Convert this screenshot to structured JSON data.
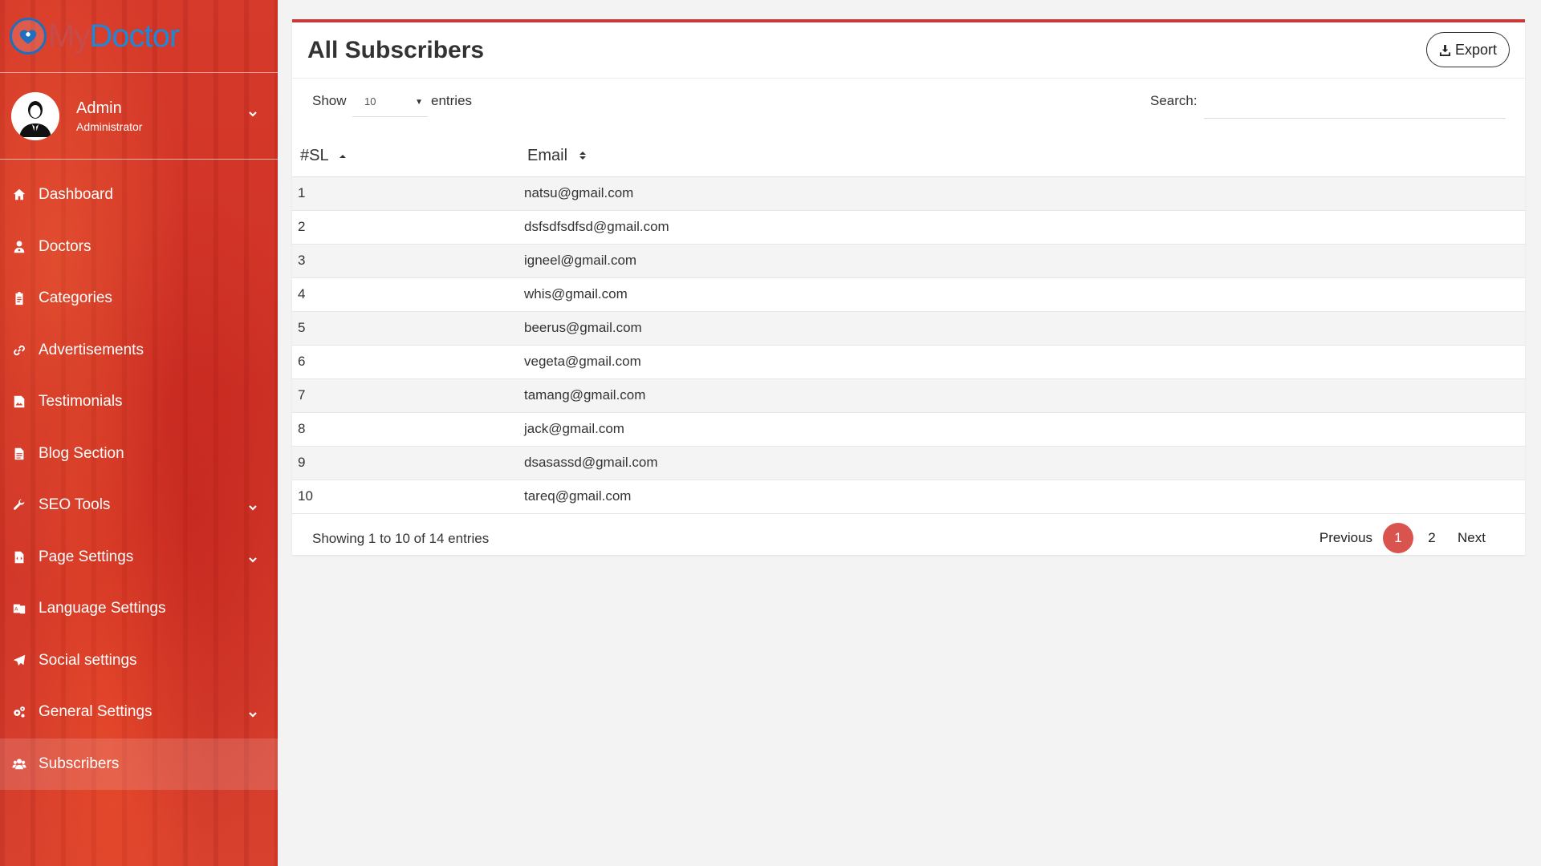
{
  "brand": {
    "part1": "My",
    "part2": "Doctor"
  },
  "user": {
    "name": "Admin",
    "role": "Administrator"
  },
  "sidebar": {
    "items": [
      {
        "label": "Dashboard",
        "icon": "home-icon"
      },
      {
        "label": "Doctors",
        "icon": "user-md-icon"
      },
      {
        "label": "Categories",
        "icon": "clipboard-icon"
      },
      {
        "label": "Advertisements",
        "icon": "link-icon"
      },
      {
        "label": "Testimonials",
        "icon": "image-file-icon"
      },
      {
        "label": "Blog Section",
        "icon": "document-icon"
      },
      {
        "label": "SEO Tools",
        "icon": "wrench-icon",
        "expandable": true
      },
      {
        "label": "Page Settings",
        "icon": "file-code-icon",
        "expandable": true
      },
      {
        "label": "Language Settings",
        "icon": "language-icon"
      },
      {
        "label": "Social settings",
        "icon": "paper-plane-icon"
      },
      {
        "label": "General Settings",
        "icon": "gears-icon",
        "expandable": true
      },
      {
        "label": "Subscribers",
        "icon": "users-icon",
        "active": true
      }
    ]
  },
  "card": {
    "title": "All Subscribers",
    "export_label": "Export"
  },
  "controls": {
    "show_label": "Show",
    "length_value": "10",
    "entries_label": "entries",
    "search_label": "Search:",
    "search_value": ""
  },
  "table": {
    "columns": [
      "#SL",
      "Email"
    ],
    "rows": [
      {
        "sl": "1",
        "email": "natsu@gmail.com"
      },
      {
        "sl": "2",
        "email": "dsfsdfsdfsd@gmail.com"
      },
      {
        "sl": "3",
        "email": "igneel@gmail.com"
      },
      {
        "sl": "4",
        "email": "whis@gmail.com"
      },
      {
        "sl": "5",
        "email": "beerus@gmail.com"
      },
      {
        "sl": "6",
        "email": "vegeta@gmail.com"
      },
      {
        "sl": "7",
        "email": "tamang@gmail.com"
      },
      {
        "sl": "8",
        "email": "jack@gmail.com"
      },
      {
        "sl": "9",
        "email": "dsasassd@gmail.com"
      },
      {
        "sl": "10",
        "email": "tareq@gmail.com"
      }
    ]
  },
  "footer": {
    "info": "Showing 1 to 10 of 14 entries",
    "previous_label": "Previous",
    "pages": [
      "1",
      "2"
    ],
    "current_page": "1",
    "next_label": "Next"
  },
  "colors": {
    "accent": "#c83a3a",
    "active_page": "#d9534f",
    "brand_blue": "#1e88d6"
  }
}
